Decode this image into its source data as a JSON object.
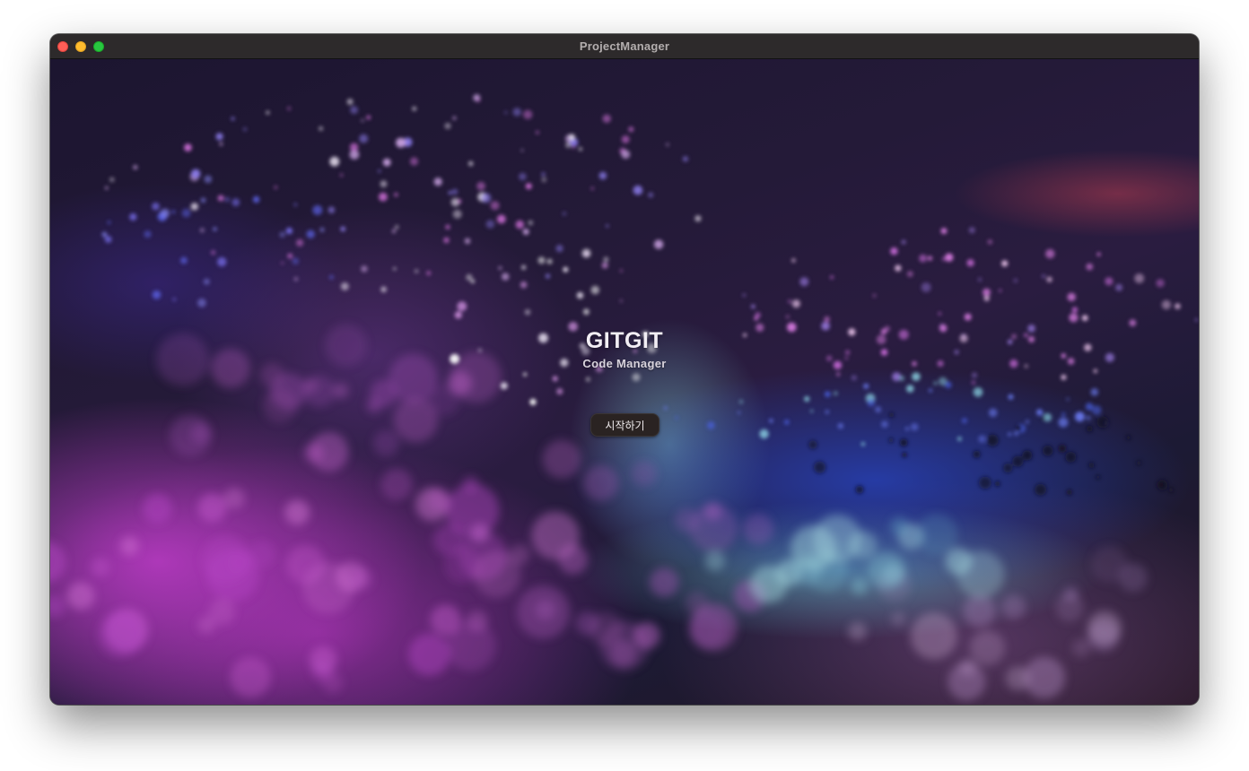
{
  "window": {
    "title": "ProjectManager",
    "controls": [
      "close-icon",
      "minimize-icon",
      "zoom-icon"
    ]
  },
  "splash": {
    "title": "GITGIT",
    "subtitle": "Code Manager",
    "start_button_label": "시작하기"
  },
  "colors": {
    "titlebar": "#2d2a2b",
    "button_bg": "#2a2322",
    "accent_magenta": "#be3cc8",
    "accent_blue": "#2846c8",
    "accent_teal": "#6ec8dc"
  }
}
